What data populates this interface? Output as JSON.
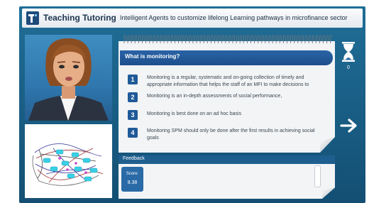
{
  "header": {
    "app_title": "Teaching Tutoring",
    "subtitle": "Intelligent Agents to customize lifelong Learning pathways in microfinance sector"
  },
  "question": {
    "title": "What is monitoring?",
    "options": [
      {
        "number": "1",
        "text": "Monitoring is a regular, systematic and on-going collection of timely and appropriate information that helps the staff of an MFI to make decisions to"
      },
      {
        "number": "2",
        "text": "Monitoring is an  in-depth assessments of social performance,"
      },
      {
        "number": "3",
        "text": "Monitoring is best done on an ad hoc basis"
      },
      {
        "number": "4",
        "text": "Monitoring SPM should only be done after the first results in achieving social goals"
      }
    ]
  },
  "timer": {
    "value": "0",
    "icon": "hourglass-icon"
  },
  "navigation": {
    "next_icon": "right-arrow-icon"
  },
  "feedback": {
    "label": "Feedback",
    "score_label": "Score:",
    "score_value": "8.38"
  },
  "colors": {
    "frame": "#195d84",
    "question_bar": "#1d4f8c",
    "option_badge": "#1f5a98",
    "score_box": "#2a6aa7"
  }
}
